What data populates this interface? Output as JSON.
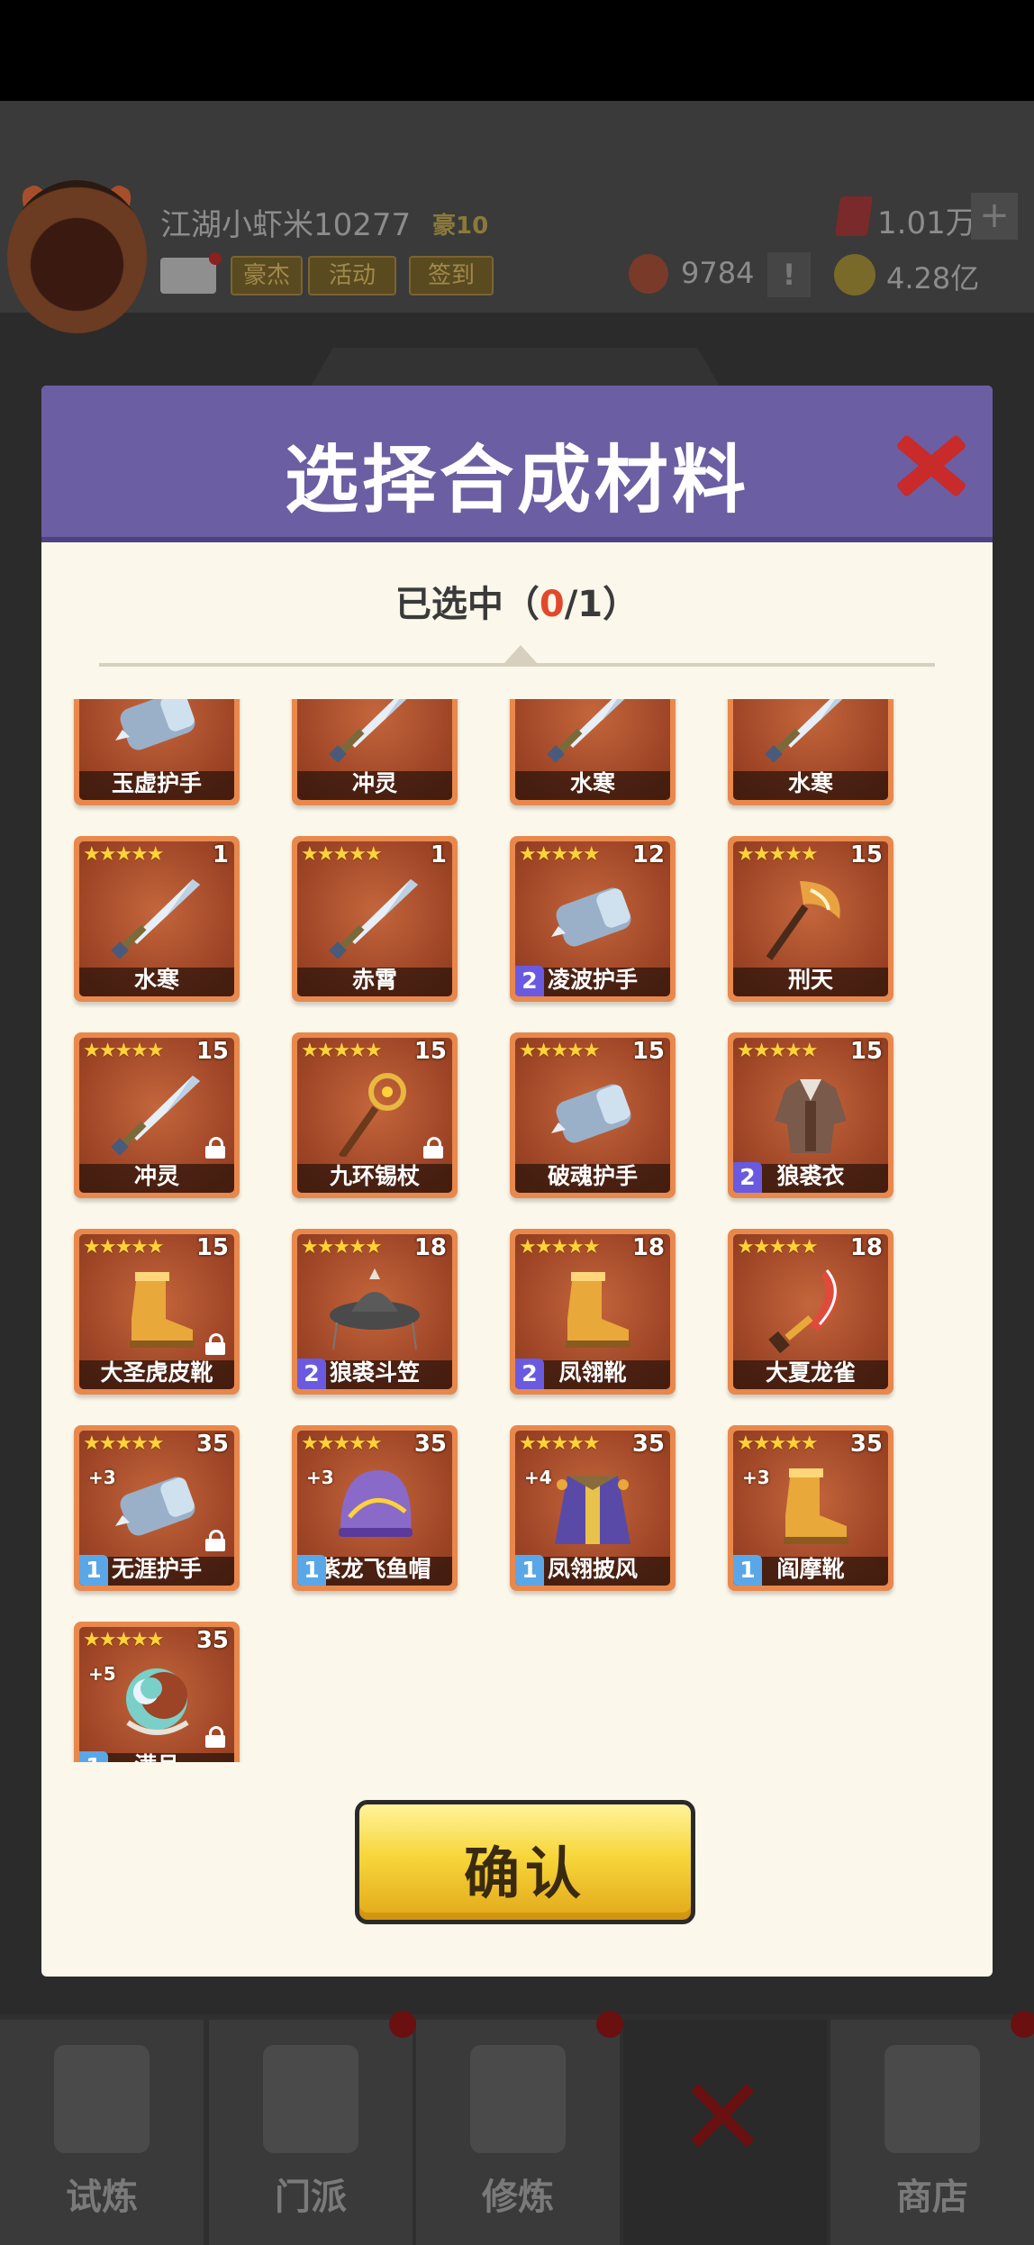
{
  "header": {
    "player_name": "江湖小虾米10277",
    "vip_label": "豪10",
    "buttons": [
      "豪杰",
      "活动",
      "签到"
    ],
    "diamond_value": "1.01万",
    "plus_label": "+",
    "token_value": "9784",
    "alert_label": "!",
    "coin_value": "4.28亿"
  },
  "modal": {
    "title": "选择合成材料",
    "selected_prefix": "已选中（",
    "selected_count": "0",
    "selected_suffix": "/1）",
    "confirm_label": "确认"
  },
  "colors": {
    "card_border": "#e9884c",
    "star": "#ffd23a",
    "count_badge_purple": "#6a5ae0",
    "count_badge_blue": "#5aa7e8",
    "header_purple": "#6b5ea2",
    "close_red": "#c92a2a",
    "confirm_yellow": "#f7d63a",
    "selected_count_red": "#e04a2a"
  },
  "items": [
    {
      "name": "玉虚护手",
      "stars": "",
      "level": "",
      "count": "",
      "plus": "",
      "locked": false,
      "icon": "gauntlet-icon",
      "partial": true
    },
    {
      "name": "冲灵",
      "stars": "",
      "level": "",
      "count": "",
      "plus": "",
      "locked": false,
      "icon": "sword-icon",
      "partial": true
    },
    {
      "name": "水寒",
      "stars": "",
      "level": "",
      "count": "",
      "plus": "",
      "locked": false,
      "icon": "sword-icon",
      "partial": true
    },
    {
      "name": "水寒",
      "stars": "",
      "level": "",
      "count": "",
      "plus": "",
      "locked": false,
      "icon": "sword-icon",
      "partial": true
    },
    {
      "name": "水寒",
      "stars": "★★★★★",
      "level": "1",
      "count": "",
      "plus": "",
      "locked": false,
      "icon": "sword-icon"
    },
    {
      "name": "赤霄",
      "stars": "★★★★★",
      "level": "1",
      "count": "",
      "plus": "",
      "locked": false,
      "icon": "sword-icon"
    },
    {
      "name": "凌波护手",
      "stars": "★★★★★",
      "level": "12",
      "count": "2",
      "count_color": "purple",
      "plus": "",
      "locked": false,
      "icon": "gauntlet-icon"
    },
    {
      "name": "刑天",
      "stars": "★★★★★",
      "level": "15",
      "count": "",
      "plus": "",
      "locked": false,
      "icon": "axe-icon"
    },
    {
      "name": "冲灵",
      "stars": "★★★★★",
      "level": "15",
      "count": "",
      "plus": "",
      "locked": true,
      "icon": "sword-icon"
    },
    {
      "name": "九环锡杖",
      "stars": "★★★★★",
      "level": "15",
      "count": "",
      "plus": "",
      "locked": true,
      "icon": "staff-icon"
    },
    {
      "name": "破魂护手",
      "stars": "★★★★★",
      "level": "15",
      "count": "",
      "plus": "",
      "locked": false,
      "icon": "gauntlet-icon"
    },
    {
      "name": "狼裘衣",
      "stars": "★★★★★",
      "level": "15",
      "count": "2",
      "count_color": "purple",
      "plus": "",
      "locked": false,
      "icon": "armor-icon"
    },
    {
      "name": "大圣虎皮靴",
      "stars": "★★★★★",
      "level": "15",
      "count": "",
      "plus": "",
      "locked": true,
      "icon": "boot-icon"
    },
    {
      "name": "狼裘斗笠",
      "stars": "★★★★★",
      "level": "18",
      "count": "2",
      "count_color": "purple",
      "plus": "",
      "locked": false,
      "icon": "hat-icon"
    },
    {
      "name": "凤翎靴",
      "stars": "★★★★★",
      "level": "18",
      "count": "2",
      "count_color": "purple",
      "plus": "",
      "locked": false,
      "icon": "boot-icon"
    },
    {
      "name": "大夏龙雀",
      "stars": "★★★★★",
      "level": "18",
      "count": "",
      "plus": "",
      "locked": false,
      "icon": "blade-icon"
    },
    {
      "name": "无涯护手",
      "stars": "★★★★★",
      "level": "35",
      "count": "1",
      "count_color": "blue",
      "plus": "+3",
      "locked": true,
      "icon": "gauntlet-icon"
    },
    {
      "name": "紫龙飞鱼帽",
      "stars": "★★★★★",
      "level": "35",
      "count": "1",
      "count_color": "blue",
      "plus": "+3",
      "locked": false,
      "icon": "helmet-icon"
    },
    {
      "name": "凤翎披风",
      "stars": "★★★★★",
      "level": "35",
      "count": "1",
      "count_color": "blue",
      "plus": "+4",
      "locked": false,
      "icon": "cloak-icon"
    },
    {
      "name": "阎摩靴",
      "stars": "★★★★★",
      "level": "35",
      "count": "1",
      "count_color": "blue",
      "plus": "+3",
      "locked": false,
      "icon": "boot-icon"
    },
    {
      "name": "满月",
      "stars": "★★★★★",
      "level": "35",
      "count": "1",
      "count_color": "blue",
      "plus": "+5",
      "locked": true,
      "icon": "moon-blade-icon"
    }
  ],
  "bottom_nav": [
    {
      "label": "试炼",
      "icon": "ninja-icon"
    },
    {
      "label": "门派",
      "icon": "temple-icon"
    },
    {
      "label": "修炼",
      "icon": "book-icon"
    },
    {
      "label": "",
      "icon": "close-icon"
    },
    {
      "label": "商店",
      "icon": "shop-icon"
    }
  ]
}
